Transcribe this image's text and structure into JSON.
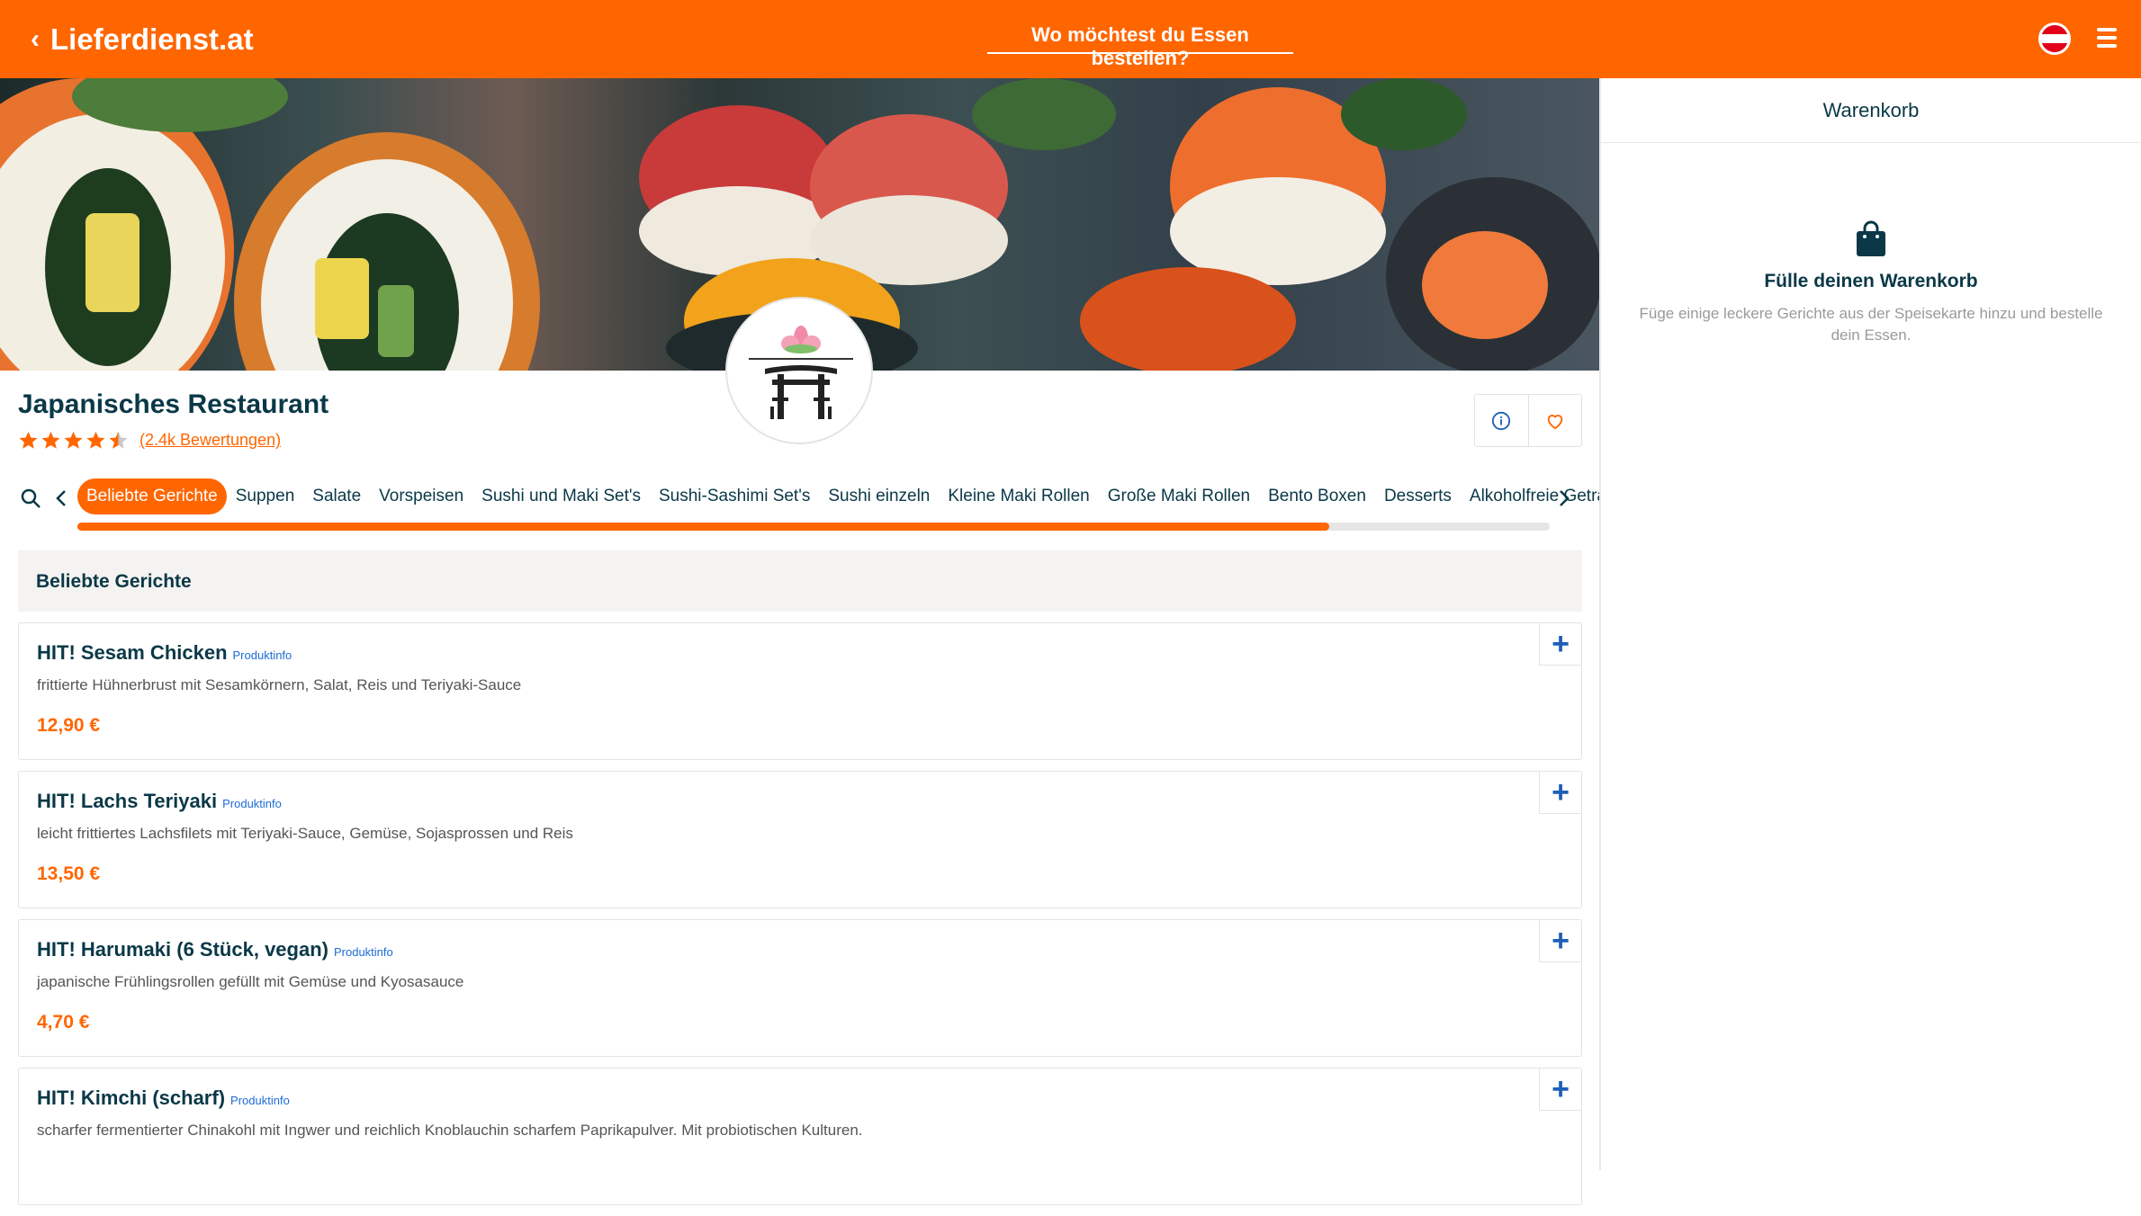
{
  "header": {
    "brand": "Lieferdienst.at",
    "address_prompt": "Wo möchtest du Essen bestellen?"
  },
  "restaurant": {
    "name": "Japanisches Restaurant",
    "rating_stars": 4.5,
    "reviews_label": "(2.4k Bewertungen)"
  },
  "categories": [
    "Beliebte Gerichte",
    "Suppen",
    "Salate",
    "Vorspeisen",
    "Sushi und Maki Set's",
    "Sushi-Sashimi Set's",
    "Sushi einzeln",
    "Kleine Maki Rollen",
    "Große Maki Rollen",
    "Bento Boxen",
    "Desserts",
    "Alkoholfreie Getränke"
  ],
  "category_scroll_progress": 0.85,
  "section": {
    "title": "Beliebte Gerichte"
  },
  "items": [
    {
      "name": "HIT! Sesam Chicken",
      "info": "Produktinfo",
      "desc": "frittierte Hühnerbrust mit Sesamkörnern, Salat, Reis und Teriyaki-Sauce",
      "price": "12,90 €"
    },
    {
      "name": "HIT! Lachs Teriyaki",
      "info": "Produktinfo",
      "desc": "leicht frittiertes Lachsfilets mit Teriyaki-Sauce, Gemüse, Sojasprossen und Reis",
      "price": "13,50 €"
    },
    {
      "name": "HIT! Harumaki (6 Stück, vegan)",
      "info": "Produktinfo",
      "desc": "japanische Frühlingsrollen gefüllt mit Gemüse und Kyosasauce",
      "price": "4,70 €"
    },
    {
      "name": "HIT! Kimchi (scharf)",
      "info": "Produktinfo",
      "desc": "scharfer fermentierter Chinakohl mit Ingwer und reichlich Knoblauchin scharfem Paprikapulver. Mit probiotischen Kulturen.",
      "price": ""
    }
  ],
  "cart": {
    "title": "Warenkorb",
    "empty_heading": "Fülle deinen Warenkorb",
    "empty_text": "Füge einige leckere Gerichte aus der Speisekarte hinzu und bestelle dein Essen."
  },
  "colors": {
    "accent": "#ff6600",
    "text": "#0a3847",
    "link": "#1d6bd6"
  },
  "icons": [
    "chevron-left-icon",
    "austria-flag-icon",
    "menu-icon",
    "search-icon",
    "info-icon",
    "heart-icon",
    "plus-icon",
    "shopping-bag-icon",
    "star-icon"
  ]
}
